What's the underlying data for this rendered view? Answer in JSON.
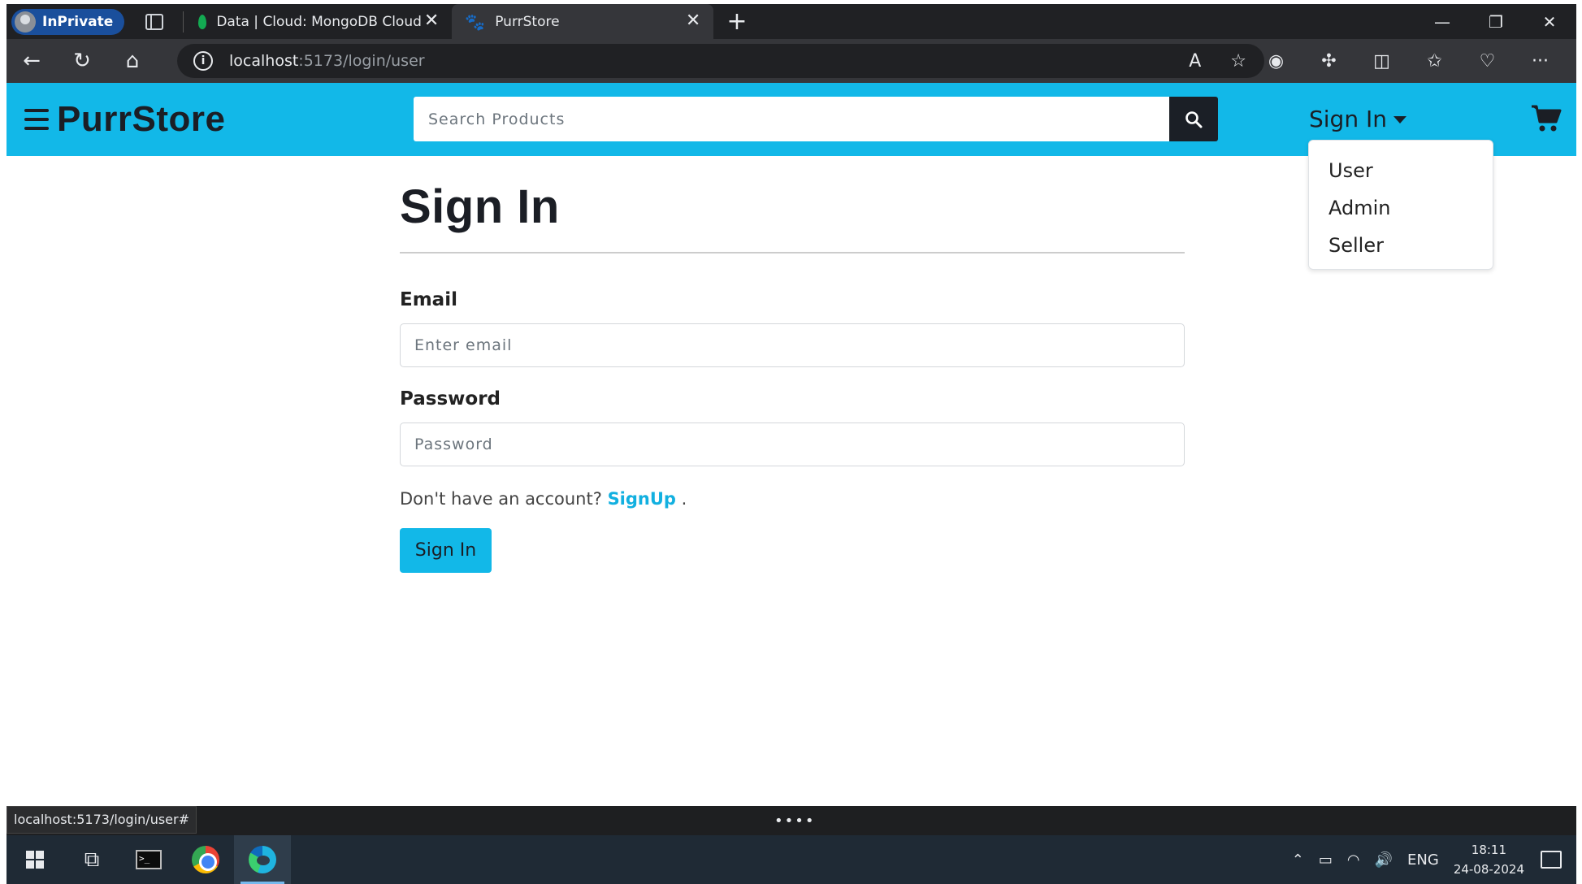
{
  "browser": {
    "inprivate_label": "InPrivate",
    "tabs": [
      {
        "title": "Data | Cloud: MongoDB Cloud",
        "close": "✕"
      },
      {
        "title": "PurrStore",
        "close": "✕"
      }
    ],
    "new_tab": "+",
    "url_host": "localhost",
    "url_path": ":5173/login/user",
    "status_url": "localhost:5173/login/user#"
  },
  "nav": {
    "brand": "PurrStore",
    "search_placeholder": "Search Products",
    "signin_label": "Sign In",
    "dropdown_items": [
      "User",
      "Admin",
      "Seller"
    ]
  },
  "form": {
    "title": "Sign In",
    "email_label": "Email",
    "email_placeholder": "Enter email",
    "password_label": "Password",
    "password_placeholder": "Password",
    "signup_prompt": "Don't have an account?",
    "signup_link": "SignUp",
    "signup_suffix": ".",
    "submit_label": "Sign In"
  },
  "taskbar": {
    "language": "ENG",
    "time": "18:11",
    "date": "24-08-2024"
  },
  "colors": {
    "accent": "#12b8e8",
    "dark": "#1b1e25",
    "link": "#12b0e0"
  }
}
